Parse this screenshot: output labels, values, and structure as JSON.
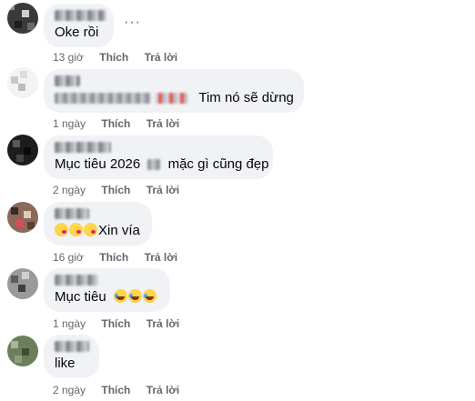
{
  "more_icon": "ellipsis-icon",
  "comments": [
    {
      "text": "Oke rồi",
      "time": "13 giờ",
      "like": "Thích",
      "reply": "Trả lời"
    },
    {
      "text": "Tim nó sẽ dừng",
      "time": "1 ngày",
      "like": "Thích",
      "reply": "Trả lời"
    },
    {
      "text_a": "Mục tiêu 2026",
      "text_b": "mặc gì cũng đẹp",
      "time": "2 ngày",
      "like": "Thích",
      "reply": "Trả lời"
    },
    {
      "text": "Xin vía",
      "emojis": [
        "kiss-emoji",
        "kiss-emoji",
        "kiss-emoji"
      ],
      "time": "16 giờ",
      "like": "Thích",
      "reply": "Trả lời"
    },
    {
      "text": "Mục tiêu",
      "emojis": [
        "laugh-cry-emoji",
        "laugh-cry-emoji",
        "laugh-cry-emoji"
      ],
      "time": "1 ngày",
      "like": "Thích",
      "reply": "Trả lời"
    },
    {
      "text": "like",
      "time": "2 ngày",
      "like": "Thích",
      "reply": "Trả lời"
    }
  ],
  "colors": {
    "bubble": "#f0f2f5",
    "meta": "#65676b",
    "text": "#050505"
  }
}
